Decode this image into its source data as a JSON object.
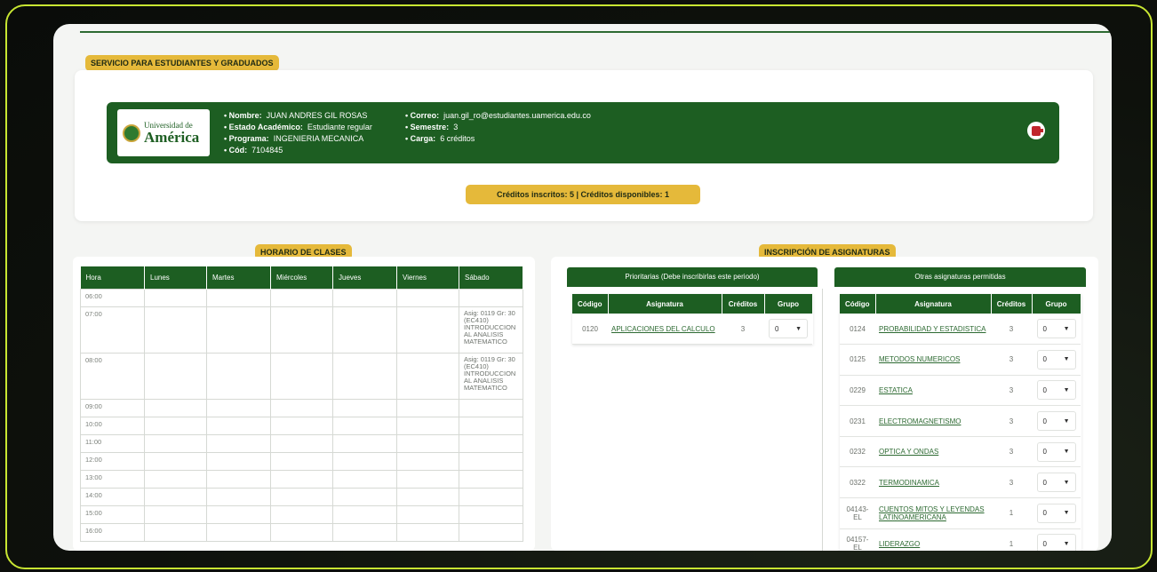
{
  "header": {
    "service_title": "SERVICIO PARA ESTUDIANTES Y GRADUADOS"
  },
  "university": {
    "logo_small": "Universidad de",
    "logo_big": "América"
  },
  "student": {
    "name_label": "• Nombre:",
    "name_value": "JUAN ANDRES GIL ROSAS",
    "status_label": "• Estado Académico:",
    "status_value": "Estudiante regular",
    "program_label": "• Programa:",
    "program_value": "INGENIERIA MECANICA",
    "code_label": "• Cód:",
    "code_value": "7104845",
    "email_label": "• Correo:",
    "email_value": "juan.gil_ro@estudiantes.uamerica.edu.co",
    "semester_label": "• Semestre:",
    "semester_value": "3",
    "load_label": "• Carga:",
    "load_value": "6 créditos"
  },
  "credits": {
    "text": "Créditos inscritos: 5  |  Créditos disponibles: 1"
  },
  "schedule": {
    "title": "HORARIO DE CLASES",
    "headers": [
      "Hora",
      "Lunes",
      "Martes",
      "Miércoles",
      "Jueves",
      "Viernes",
      "Sábado"
    ],
    "rows": [
      {
        "hour": "06:00",
        "saturday": ""
      },
      {
        "hour": "07:00",
        "saturday": "Asig: 0119 Gr: 30 (EC410) INTRODUCCION AL ANALISIS MATEMATICO"
      },
      {
        "hour": "08:00",
        "saturday": "Asig: 0119 Gr: 30 (EC410) INTRODUCCION AL ANALISIS MATEMATICO"
      },
      {
        "hour": "09:00",
        "saturday": ""
      },
      {
        "hour": "10:00",
        "saturday": ""
      },
      {
        "hour": "11:00",
        "saturday": ""
      },
      {
        "hour": "12:00",
        "saturday": ""
      },
      {
        "hour": "13:00",
        "saturday": ""
      },
      {
        "hour": "14:00",
        "saturday": ""
      },
      {
        "hour": "15:00",
        "saturday": ""
      },
      {
        "hour": "16:00",
        "saturday": ""
      }
    ]
  },
  "enrollment": {
    "title": "INSCRIPCIÓN DE ASIGNATURAS",
    "priority": {
      "heading": "Prioritarias (Debe inscribirlas este periodo)",
      "headers": [
        "Código",
        "Asignatura",
        "Créditos",
        "Grupo"
      ],
      "rows": [
        {
          "code": "0120",
          "subject": "APLICACIONES DEL CALCULO",
          "credits": "3",
          "group": "0"
        }
      ]
    },
    "others": {
      "heading": "Otras asignaturas permitidas",
      "headers": [
        "Código",
        "Asignatura",
        "Créditos",
        "Grupo"
      ],
      "rows": [
        {
          "code": "0124",
          "subject": "PROBABILIDAD Y ESTADISTICA",
          "credits": "3",
          "group": "0"
        },
        {
          "code": "0125",
          "subject": "METODOS NUMERICOS",
          "credits": "3",
          "group": "0"
        },
        {
          "code": "0229",
          "subject": "ESTATICA",
          "credits": "3",
          "group": "0"
        },
        {
          "code": "0231",
          "subject": "ELECTROMAGNETISMO",
          "credits": "3",
          "group": "0"
        },
        {
          "code": "0232",
          "subject": "OPTICA Y ONDAS",
          "credits": "3",
          "group": "0"
        },
        {
          "code": "0322",
          "subject": "TERMODINAMICA",
          "credits": "3",
          "group": "0"
        },
        {
          "code": "04143-EL",
          "subject": "CUENTOS MITOS Y LEYENDAS LATINOAMERICANA",
          "credits": "1",
          "group": "0"
        },
        {
          "code": "04157-EL",
          "subject": "LIDERAZGO",
          "credits": "1",
          "group": "0"
        }
      ]
    }
  },
  "colors": {
    "brand_green": "#1d5e22",
    "accent_gold": "#e5b93a",
    "frame_lime": "#c8e632"
  }
}
